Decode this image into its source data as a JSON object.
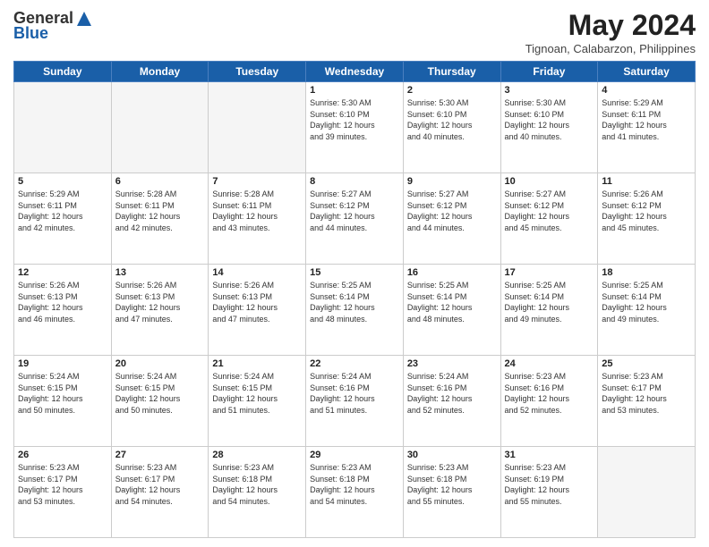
{
  "header": {
    "logo_general": "General",
    "logo_blue": "Blue",
    "month_title": "May 2024",
    "location": "Tignoan, Calabarzon, Philippines"
  },
  "weekdays": [
    "Sunday",
    "Monday",
    "Tuesday",
    "Wednesday",
    "Thursday",
    "Friday",
    "Saturday"
  ],
  "weeks": [
    [
      {
        "day": "",
        "info": ""
      },
      {
        "day": "",
        "info": ""
      },
      {
        "day": "",
        "info": ""
      },
      {
        "day": "1",
        "info": "Sunrise: 5:30 AM\nSunset: 6:10 PM\nDaylight: 12 hours\nand 39 minutes."
      },
      {
        "day": "2",
        "info": "Sunrise: 5:30 AM\nSunset: 6:10 PM\nDaylight: 12 hours\nand 40 minutes."
      },
      {
        "day": "3",
        "info": "Sunrise: 5:30 AM\nSunset: 6:10 PM\nDaylight: 12 hours\nand 40 minutes."
      },
      {
        "day": "4",
        "info": "Sunrise: 5:29 AM\nSunset: 6:11 PM\nDaylight: 12 hours\nand 41 minutes."
      }
    ],
    [
      {
        "day": "5",
        "info": "Sunrise: 5:29 AM\nSunset: 6:11 PM\nDaylight: 12 hours\nand 42 minutes."
      },
      {
        "day": "6",
        "info": "Sunrise: 5:28 AM\nSunset: 6:11 PM\nDaylight: 12 hours\nand 42 minutes."
      },
      {
        "day": "7",
        "info": "Sunrise: 5:28 AM\nSunset: 6:11 PM\nDaylight: 12 hours\nand 43 minutes."
      },
      {
        "day": "8",
        "info": "Sunrise: 5:27 AM\nSunset: 6:12 PM\nDaylight: 12 hours\nand 44 minutes."
      },
      {
        "day": "9",
        "info": "Sunrise: 5:27 AM\nSunset: 6:12 PM\nDaylight: 12 hours\nand 44 minutes."
      },
      {
        "day": "10",
        "info": "Sunrise: 5:27 AM\nSunset: 6:12 PM\nDaylight: 12 hours\nand 45 minutes."
      },
      {
        "day": "11",
        "info": "Sunrise: 5:26 AM\nSunset: 6:12 PM\nDaylight: 12 hours\nand 45 minutes."
      }
    ],
    [
      {
        "day": "12",
        "info": "Sunrise: 5:26 AM\nSunset: 6:13 PM\nDaylight: 12 hours\nand 46 minutes."
      },
      {
        "day": "13",
        "info": "Sunrise: 5:26 AM\nSunset: 6:13 PM\nDaylight: 12 hours\nand 47 minutes."
      },
      {
        "day": "14",
        "info": "Sunrise: 5:26 AM\nSunset: 6:13 PM\nDaylight: 12 hours\nand 47 minutes."
      },
      {
        "day": "15",
        "info": "Sunrise: 5:25 AM\nSunset: 6:14 PM\nDaylight: 12 hours\nand 48 minutes."
      },
      {
        "day": "16",
        "info": "Sunrise: 5:25 AM\nSunset: 6:14 PM\nDaylight: 12 hours\nand 48 minutes."
      },
      {
        "day": "17",
        "info": "Sunrise: 5:25 AM\nSunset: 6:14 PM\nDaylight: 12 hours\nand 49 minutes."
      },
      {
        "day": "18",
        "info": "Sunrise: 5:25 AM\nSunset: 6:14 PM\nDaylight: 12 hours\nand 49 minutes."
      }
    ],
    [
      {
        "day": "19",
        "info": "Sunrise: 5:24 AM\nSunset: 6:15 PM\nDaylight: 12 hours\nand 50 minutes."
      },
      {
        "day": "20",
        "info": "Sunrise: 5:24 AM\nSunset: 6:15 PM\nDaylight: 12 hours\nand 50 minutes."
      },
      {
        "day": "21",
        "info": "Sunrise: 5:24 AM\nSunset: 6:15 PM\nDaylight: 12 hours\nand 51 minutes."
      },
      {
        "day": "22",
        "info": "Sunrise: 5:24 AM\nSunset: 6:16 PM\nDaylight: 12 hours\nand 51 minutes."
      },
      {
        "day": "23",
        "info": "Sunrise: 5:24 AM\nSunset: 6:16 PM\nDaylight: 12 hours\nand 52 minutes."
      },
      {
        "day": "24",
        "info": "Sunrise: 5:23 AM\nSunset: 6:16 PM\nDaylight: 12 hours\nand 52 minutes."
      },
      {
        "day": "25",
        "info": "Sunrise: 5:23 AM\nSunset: 6:17 PM\nDaylight: 12 hours\nand 53 minutes."
      }
    ],
    [
      {
        "day": "26",
        "info": "Sunrise: 5:23 AM\nSunset: 6:17 PM\nDaylight: 12 hours\nand 53 minutes."
      },
      {
        "day": "27",
        "info": "Sunrise: 5:23 AM\nSunset: 6:17 PM\nDaylight: 12 hours\nand 54 minutes."
      },
      {
        "day": "28",
        "info": "Sunrise: 5:23 AM\nSunset: 6:18 PM\nDaylight: 12 hours\nand 54 minutes."
      },
      {
        "day": "29",
        "info": "Sunrise: 5:23 AM\nSunset: 6:18 PM\nDaylight: 12 hours\nand 54 minutes."
      },
      {
        "day": "30",
        "info": "Sunrise: 5:23 AM\nSunset: 6:18 PM\nDaylight: 12 hours\nand 55 minutes."
      },
      {
        "day": "31",
        "info": "Sunrise: 5:23 AM\nSunset: 6:19 PM\nDaylight: 12 hours\nand 55 minutes."
      },
      {
        "day": "",
        "info": ""
      }
    ]
  ]
}
